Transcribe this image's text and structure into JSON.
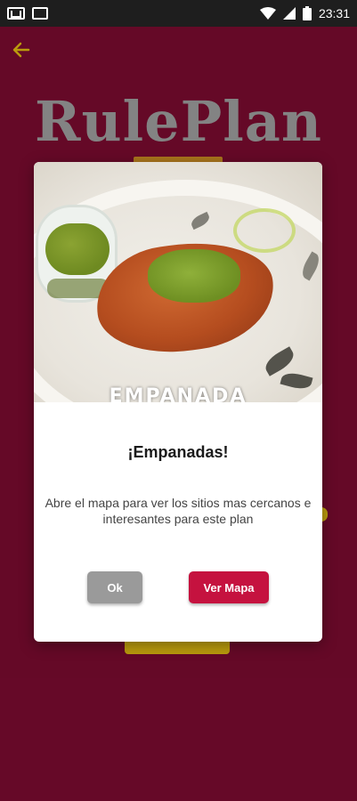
{
  "status_bar": {
    "time": "23:31",
    "left_icons": [
      "gmail-icon",
      "app-notification-icon"
    ],
    "right_icons": [
      "wifi-icon",
      "signal-icon",
      "battery-icon"
    ]
  },
  "app": {
    "logo_text": "RulePlan",
    "back_icon": "arrow-left-icon",
    "colors": {
      "background": "#6b0a2a",
      "accent": "#c5a40e",
      "logo": "#8b8b8b",
      "back_arrow": "#c5a40e"
    }
  },
  "dialog": {
    "image_caption": "EMPANADA",
    "title": "¡Empanadas!",
    "message": "Abre el mapa para ver los sitios mas cercanos e interesantes para este plan",
    "buttons": {
      "ok_label": "Ok",
      "map_label": "Ver Mapa"
    },
    "colors": {
      "ok_button": "#9a9a9a",
      "map_button": "#c5123f"
    }
  }
}
